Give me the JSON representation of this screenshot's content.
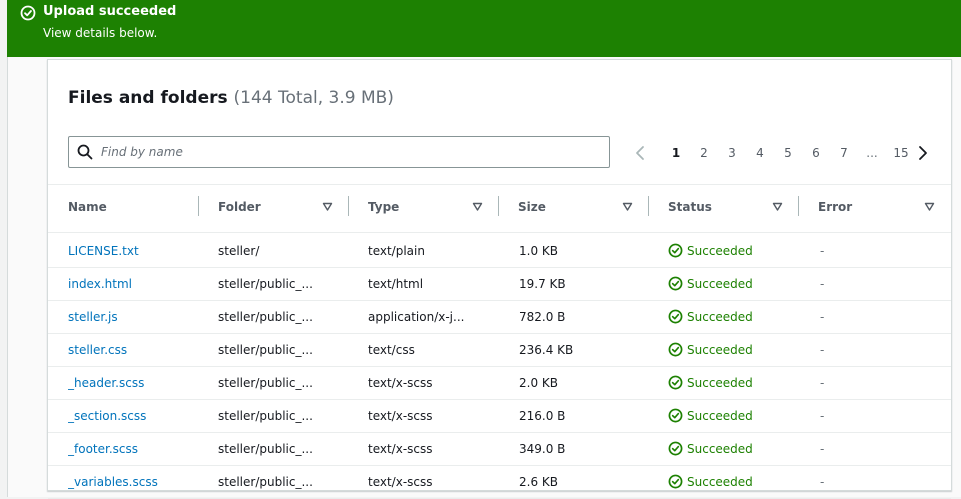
{
  "flash": {
    "title": "Upload succeeded",
    "subtitle": "View details below.",
    "color": "#1d8102",
    "icon": "check-circle-icon"
  },
  "files": {
    "title": "Files and folders",
    "summary": "(144 Total, 3.9 MB)",
    "search_placeholder": "Find by name",
    "pagination": {
      "prev_icon": "chevron-left-icon",
      "next_icon": "chevron-right-icon",
      "current": "1",
      "pages": [
        "1",
        "2",
        "3",
        "4",
        "5",
        "6",
        "7"
      ],
      "ellipsis": "...",
      "last": "15"
    },
    "columns": [
      "Name",
      "Folder",
      "Type",
      "Size",
      "Status",
      "Error"
    ],
    "rows": [
      {
        "name": "LICENSE.txt",
        "folder": "steller/",
        "type": "text/plain",
        "size": "1.0 KB",
        "status": "Succeeded",
        "error": "-"
      },
      {
        "name": "index.html",
        "folder": "steller/public_...",
        "type": "text/html",
        "size": "19.7 KB",
        "status": "Succeeded",
        "error": "-"
      },
      {
        "name": "steller.js",
        "folder": "steller/public_...",
        "type": "application/x-j...",
        "size": "782.0 B",
        "status": "Succeeded",
        "error": "-"
      },
      {
        "name": "steller.css",
        "folder": "steller/public_...",
        "type": "text/css",
        "size": "236.4 KB",
        "status": "Succeeded",
        "error": "-"
      },
      {
        "name": "_header.scss",
        "folder": "steller/public_...",
        "type": "text/x-scss",
        "size": "2.0 KB",
        "status": "Succeeded",
        "error": "-"
      },
      {
        "name": "_section.scss",
        "folder": "steller/public_...",
        "type": "text/x-scss",
        "size": "216.0 B",
        "status": "Succeeded",
        "error": "-"
      },
      {
        "name": "_footer.scss",
        "folder": "steller/public_...",
        "type": "text/x-scss",
        "size": "349.0 B",
        "status": "Succeeded",
        "error": "-"
      },
      {
        "name": "_variables.scss",
        "folder": "steller/public_...",
        "type": "text/x-scss",
        "size": "2.6 KB",
        "status": "Succeeded",
        "error": "-"
      }
    ],
    "status_color": "#1d8102",
    "link_color": "#0073bb"
  }
}
